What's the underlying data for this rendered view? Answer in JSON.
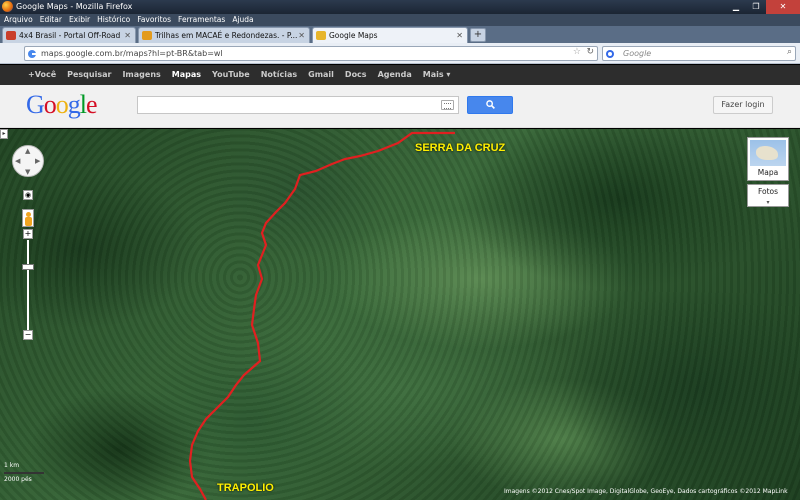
{
  "window": {
    "title": "Google Maps - Mozilla Firefox"
  },
  "menu": [
    "Arquivo",
    "Editar",
    "Exibir",
    "Histórico",
    "Favoritos",
    "Ferramentas",
    "Ajuda"
  ],
  "tabs": [
    {
      "label": "4x4 Brasil - Portal Off-Road",
      "fav_color": "#c93d2a"
    },
    {
      "label": "Trilhas em MACAÉ e Redondezas. - P...",
      "fav_color": "#e39b1c"
    },
    {
      "label": "Google Maps",
      "fav_color": "#e7b52b"
    }
  ],
  "nav": {
    "url": "maps.google.com.br/maps?hl=pt-BR&tab=wl",
    "search_placeholder": "Google"
  },
  "gbar": [
    "+Você",
    "Pesquisar",
    "Imagens",
    "Mapas",
    "YouTube",
    "Notícias",
    "Gmail",
    "Docs",
    "Agenda",
    "Mais ▾"
  ],
  "gbar_active": "Mapas",
  "header": {
    "logo": [
      "G",
      "o",
      "o",
      "g",
      "l",
      "e"
    ],
    "login_label": "Fazer login"
  },
  "logo_colors": [
    "#3369e8",
    "#d50f25",
    "#eeb211",
    "#3369e8",
    "#009925",
    "#d50f25"
  ],
  "map": {
    "places": {
      "north": "SERRA DA CRUZ",
      "south": "TRAPOLIO"
    },
    "map_type_label": "Mapa",
    "photos_label": "Fotos",
    "scale": {
      "km": "1 km",
      "ft": "2000 pés"
    },
    "copyright": "Imagens ©2012 Cnes/Spot Image, DigitalGlobe, GeoEye, Dados cartográficos ©2012 MapLink",
    "route_color": "#e02020"
  }
}
